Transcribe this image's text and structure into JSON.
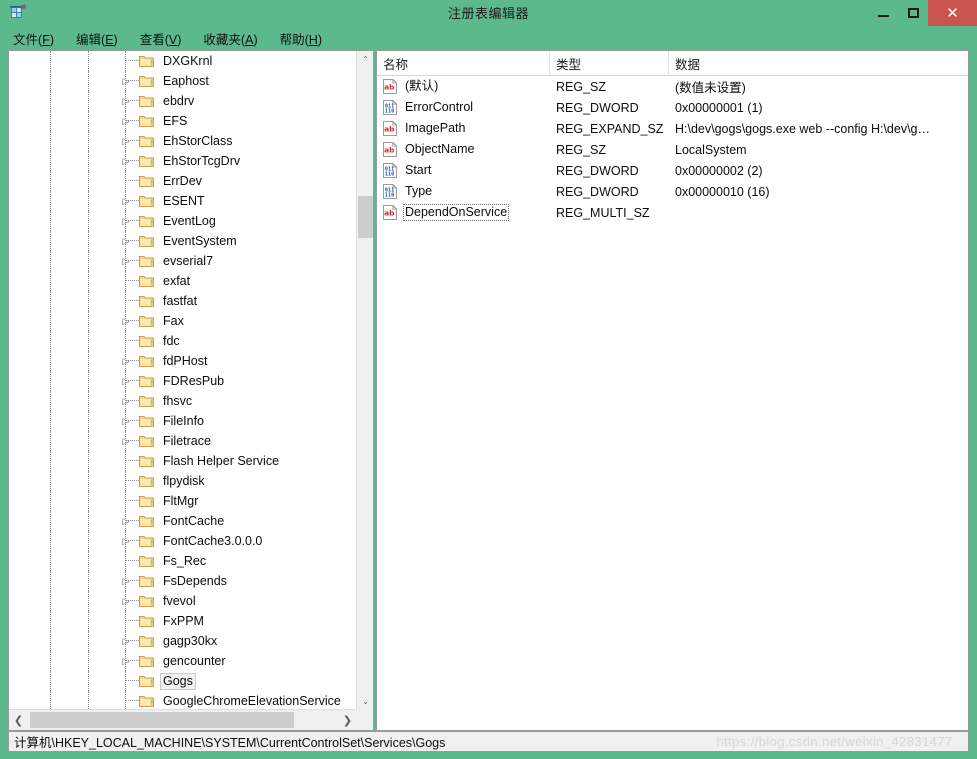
{
  "window": {
    "title": "注册表编辑器",
    "icon": "registry-editor-icon",
    "accent_green": "#5cb98d",
    "close_red": "#c9554f",
    "controls": {
      "minimize": "—",
      "maximize": "□",
      "close": "✕"
    }
  },
  "menubar": {
    "items": [
      {
        "label": "文件",
        "accel": "F"
      },
      {
        "label": "编辑",
        "accel": "E"
      },
      {
        "label": "查看",
        "accel": "V"
      },
      {
        "label": "收藏夹",
        "accel": "A"
      },
      {
        "label": "帮助",
        "accel": "H"
      }
    ]
  },
  "tree": {
    "items": [
      {
        "label": "DXGKrnl",
        "expandable": false,
        "selected": false
      },
      {
        "label": "Eaphost",
        "expandable": true,
        "selected": false
      },
      {
        "label": "ebdrv",
        "expandable": true,
        "selected": false
      },
      {
        "label": "EFS",
        "expandable": true,
        "selected": false
      },
      {
        "label": "EhStorClass",
        "expandable": true,
        "selected": false
      },
      {
        "label": "EhStorTcgDrv",
        "expandable": true,
        "selected": false
      },
      {
        "label": "ErrDev",
        "expandable": false,
        "selected": false
      },
      {
        "label": "ESENT",
        "expandable": true,
        "selected": false
      },
      {
        "label": "EventLog",
        "expandable": true,
        "selected": false
      },
      {
        "label": "EventSystem",
        "expandable": true,
        "selected": false
      },
      {
        "label": "evserial7",
        "expandable": true,
        "selected": false
      },
      {
        "label": "exfat",
        "expandable": false,
        "selected": false
      },
      {
        "label": "fastfat",
        "expandable": false,
        "selected": false
      },
      {
        "label": "Fax",
        "expandable": true,
        "selected": false
      },
      {
        "label": "fdc",
        "expandable": false,
        "selected": false
      },
      {
        "label": "fdPHost",
        "expandable": true,
        "selected": false
      },
      {
        "label": "FDResPub",
        "expandable": true,
        "selected": false
      },
      {
        "label": "fhsvc",
        "expandable": true,
        "selected": false
      },
      {
        "label": "FileInfo",
        "expandable": true,
        "selected": false
      },
      {
        "label": "Filetrace",
        "expandable": true,
        "selected": false
      },
      {
        "label": "Flash Helper Service",
        "expandable": false,
        "selected": false
      },
      {
        "label": "flpydisk",
        "expandable": false,
        "selected": false
      },
      {
        "label": "FltMgr",
        "expandable": false,
        "selected": false
      },
      {
        "label": "FontCache",
        "expandable": true,
        "selected": false
      },
      {
        "label": "FontCache3.0.0.0",
        "expandable": true,
        "selected": false
      },
      {
        "label": "Fs_Rec",
        "expandable": false,
        "selected": false
      },
      {
        "label": "FsDepends",
        "expandable": true,
        "selected": false
      },
      {
        "label": "fvevol",
        "expandable": true,
        "selected": false
      },
      {
        "label": "FxPPM",
        "expandable": false,
        "selected": false
      },
      {
        "label": "gagp30kx",
        "expandable": true,
        "selected": false
      },
      {
        "label": "gencounter",
        "expandable": true,
        "selected": false
      },
      {
        "label": "Gogs",
        "expandable": false,
        "selected": true
      },
      {
        "label": "GoogleChromeElevationService",
        "expandable": false,
        "selected": false
      }
    ],
    "expander_glyph": "▷",
    "scroll": {
      "up_arrow": "⌃",
      "down_arrow": "⌄",
      "left_arrow": "❮",
      "right_arrow": "❯"
    }
  },
  "list": {
    "columns": [
      "名称",
      "类型",
      "数据"
    ],
    "rows": [
      {
        "name": "(默认)",
        "icon": "string-value-icon",
        "type": "REG_SZ",
        "data": "(数值未设置)",
        "focused": false
      },
      {
        "name": "ErrorControl",
        "icon": "dword-value-icon",
        "type": "REG_DWORD",
        "data": "0x00000001 (1)",
        "focused": false
      },
      {
        "name": "ImagePath",
        "icon": "string-value-icon",
        "type": "REG_EXPAND_SZ",
        "data": "H:\\dev\\gogs\\gogs.exe web --config H:\\dev\\g…",
        "focused": false
      },
      {
        "name": "ObjectName",
        "icon": "string-value-icon",
        "type": "REG_SZ",
        "data": "LocalSystem",
        "focused": false
      },
      {
        "name": "Start",
        "icon": "dword-value-icon",
        "type": "REG_DWORD",
        "data": "0x00000002 (2)",
        "focused": false
      },
      {
        "name": "Type",
        "icon": "dword-value-icon",
        "type": "REG_DWORD",
        "data": "0x00000010 (16)",
        "focused": false
      },
      {
        "name": "DependOnService",
        "icon": "string-value-icon",
        "type": "REG_MULTI_SZ",
        "data": "",
        "focused": true
      }
    ]
  },
  "statusbar": {
    "path": "计算机\\HKEY_LOCAL_MACHINE\\SYSTEM\\CurrentControlSet\\Services\\Gogs"
  },
  "watermark": {
    "text": "https://blog.csdn.net/weixin_42831477"
  }
}
